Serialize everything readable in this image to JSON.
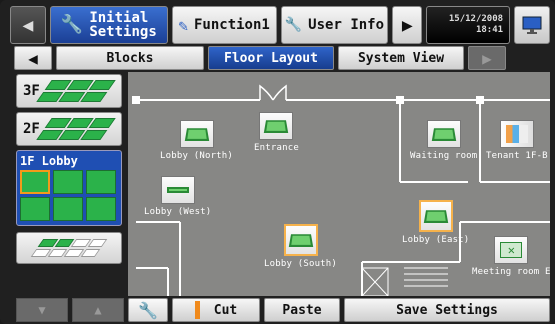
{
  "topbar": {
    "initial_label": "Initial\nSettings",
    "function_label": "Function1",
    "userinfo_label": "User Info",
    "date": "15/12/2008",
    "time": "18:41"
  },
  "tabs": {
    "blocks": "Blocks",
    "floor_layout": "Floor Layout",
    "system_view": "System View"
  },
  "floors": {
    "f3": "3F",
    "f2": "2F",
    "f1": "1F Lobby"
  },
  "units": {
    "lobby_north": "Lobby (North)",
    "entrance": "Entrance",
    "waiting_room": "Waiting room",
    "tenant_1fb": "Tenant 1F-B",
    "lobby_west": "Lobby (West)",
    "lobby_east": "Lobby (East)",
    "lobby_south": "Lobby (South)",
    "meeting_room_e": "Meeting room E"
  },
  "bottombar": {
    "cut": "Cut",
    "paste": "Paste",
    "save": "Save Settings"
  },
  "colors": {
    "accent_blue": "#1f4fb3",
    "unit_green": "#2bb24a",
    "selection_orange": "#f39a1a",
    "plan_bg": "#878785"
  }
}
